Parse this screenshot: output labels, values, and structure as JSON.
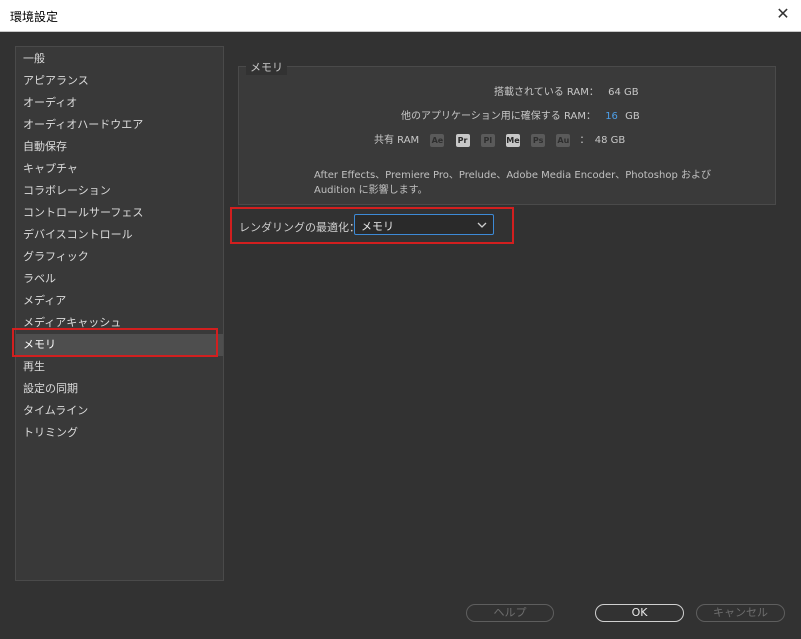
{
  "window": {
    "title": "環境設定",
    "close_glyph": "✕"
  },
  "sidebar": {
    "items": [
      {
        "label": "一般"
      },
      {
        "label": "アピアランス"
      },
      {
        "label": "オーディオ"
      },
      {
        "label": "オーディオハードウエア"
      },
      {
        "label": "自動保存"
      },
      {
        "label": "キャプチャ"
      },
      {
        "label": "コラボレーション"
      },
      {
        "label": "コントロールサーフェス"
      },
      {
        "label": "デバイスコントロール"
      },
      {
        "label": "グラフィック"
      },
      {
        "label": "ラベル"
      },
      {
        "label": "メディア"
      },
      {
        "label": "メディアキャッシュ"
      },
      {
        "label": "メモリ"
      },
      {
        "label": "再生"
      },
      {
        "label": "設定の同期"
      },
      {
        "label": "タイムライン"
      },
      {
        "label": "トリミング"
      }
    ],
    "selected_label": "メモリ"
  },
  "memory": {
    "group_title": "メモリ",
    "installed_label": "搭載されている RAM：",
    "installed_value": "64 GB",
    "reserved_label": "他のアプリケーション用に確保する RAM：",
    "reserved_value": "16",
    "reserved_unit": "GB",
    "shared_label": "共有 RAM",
    "apps": [
      {
        "abbr": "Ae",
        "active": false
      },
      {
        "abbr": "Pr",
        "active": true
      },
      {
        "abbr": "Pl",
        "active": false
      },
      {
        "abbr": "Me",
        "active": true
      },
      {
        "abbr": "Ps",
        "active": false
      },
      {
        "abbr": "Au",
        "active": false
      }
    ],
    "shared_sep": "：",
    "shared_value": "48 GB",
    "note_line1": "After Effects、Premiere Pro、Prelude、Adobe Media Encoder、Photoshop および",
    "note_line2": "Audition に影響します。"
  },
  "render": {
    "label": "レンダリングの最適化：",
    "selected": "メモリ"
  },
  "buttons": {
    "help": "ヘルプ",
    "ok": "OK",
    "cancel": "キャンセル"
  },
  "colors": {
    "accent": "#4d9fe8",
    "highlight": "#d21f1f",
    "background": "#323232"
  }
}
